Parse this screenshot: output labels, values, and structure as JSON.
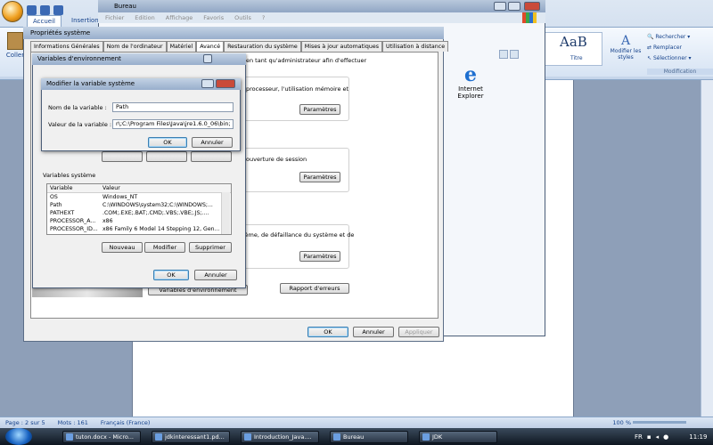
{
  "word": {
    "tabs": [
      "Accueil",
      "Insertion"
    ],
    "coller_label": "Coller",
    "style_preview": "AaB",
    "style_name": "Titre",
    "modify_styles": "Modifier les styles",
    "find": "Rechercher",
    "replace": "Remplacer",
    "select": "Sélectionner",
    "group_modification": "Modification",
    "status": {
      "page": "Page : 2 sur 5",
      "words": "Mots : 161",
      "language": "Français (France)",
      "zoom": "100 %"
    }
  },
  "bureau": {
    "title": "Bureau",
    "menu": [
      "Fichier",
      "Edition",
      "Affichage",
      "Favoris",
      "Outils",
      "?"
    ],
    "ie_label": "Internet Explorer"
  },
  "props": {
    "title": "Propriétés système",
    "tabs": [
      "Informations Générales",
      "Nom de l'ordinateur",
      "Matériel",
      "Avancé",
      "Restauration du système",
      "Mises à jour automatiques",
      "Utilisation à distance"
    ],
    "intro": "en tant qu'administrateur afin d'effectuer",
    "perf_text": "processeur, l'utilisation mémoire et",
    "profile_text": "ouverture de session",
    "startup_text": "tème, de défaillance du système et de",
    "btn_params": "Paramètres",
    "btn_env": "Variables d'environnement",
    "btn_errors": "Rapport d'erreurs",
    "btn_ok": "OK",
    "btn_cancel": "Annuler",
    "btn_apply": "Appliquer"
  },
  "env": {
    "title": "Variables d'environnement",
    "sys_label": "Variables système",
    "col_var": "Variable",
    "col_val": "Valeur",
    "rows": [
      {
        "name": "OS",
        "value": "Windows_NT"
      },
      {
        "name": "Path",
        "value": "C:\\WINDOWS\\system32;C:\\WINDOWS;..."
      },
      {
        "name": "PATHEXT",
        "value": ".COM;.EXE;.BAT;.CMD;.VBS;.VBE;.JS;...."
      },
      {
        "name": "PROCESSOR_A...",
        "value": "x86"
      },
      {
        "name": "PROCESSOR_ID...",
        "value": "x86 Family 6 Model 14 Stepping 12, Gen..."
      }
    ],
    "btn_new": "Nouveau",
    "btn_edit": "Modifier",
    "btn_delete": "Supprimer",
    "btn_ok": "OK",
    "btn_cancel": "Annuler"
  },
  "modify": {
    "title": "Modifier la variable système",
    "name_label": "Nom de la variable :",
    "name_value": "Path",
    "value_label": "Valeur de la variable :",
    "value_value": "r\\;C:\\Program Files\\Java\\jre1.6.0_06\\bin;",
    "btn_ok": "OK",
    "btn_cancel": "Annuler"
  },
  "taskbar": {
    "items": [
      "tuton.docx - Micro...",
      "jdkinteressant1.pd...",
      "Introduction_Java....",
      "Bureau",
      "JDK"
    ],
    "lang": "FR",
    "clock": "11:19"
  }
}
